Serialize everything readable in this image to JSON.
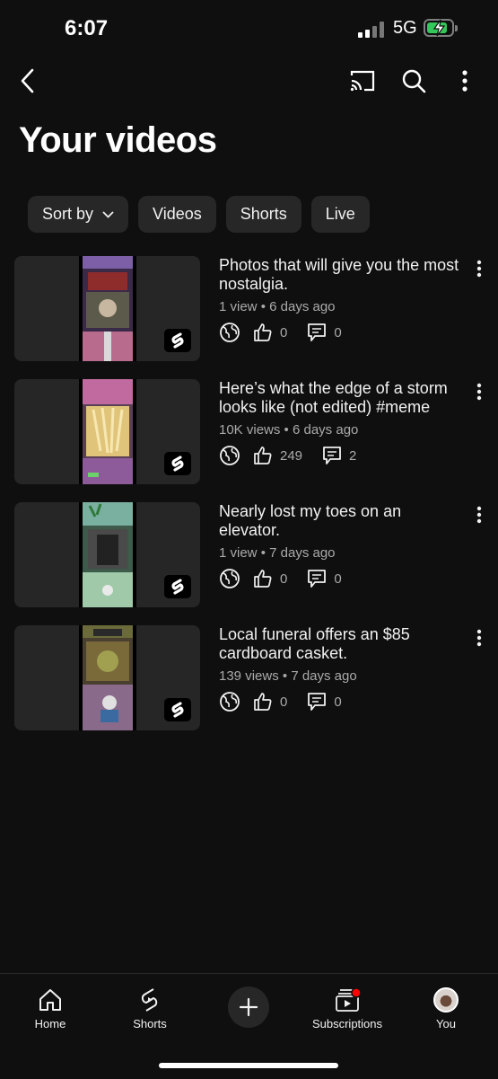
{
  "status": {
    "time": "6:07",
    "network": "5G"
  },
  "header": {
    "title": "Your videos"
  },
  "filters": {
    "sort_label": "Sort by",
    "chips": [
      "Videos",
      "Shorts",
      "Live"
    ]
  },
  "videos": [
    {
      "title": "Photos that will give you the most nostalgia.",
      "views": "1 view",
      "age": "6 days ago",
      "likes": "0",
      "comments": "0"
    },
    {
      "title": "Here’s what the edge of a storm looks like (not edited) #meme",
      "views": "10K views",
      "age": "6 days ago",
      "likes": "249",
      "comments": "2"
    },
    {
      "title": "Nearly lost my toes on an elevator.",
      "views": "1 view",
      "age": "7 days ago",
      "likes": "0",
      "comments": "0"
    },
    {
      "title": "Local funeral offers an $85 cardboard casket.",
      "views": "139 views",
      "age": "7 days ago",
      "likes": "0",
      "comments": "0"
    }
  ],
  "meta_separator": "•",
  "nav": {
    "home": "Home",
    "shorts": "Shorts",
    "subscriptions": "Subscriptions",
    "you": "You"
  },
  "colors": {
    "background": "#0f0f0f",
    "chip": "#272727",
    "accent_red": "#ff0000",
    "battery_green": "#34c759"
  }
}
